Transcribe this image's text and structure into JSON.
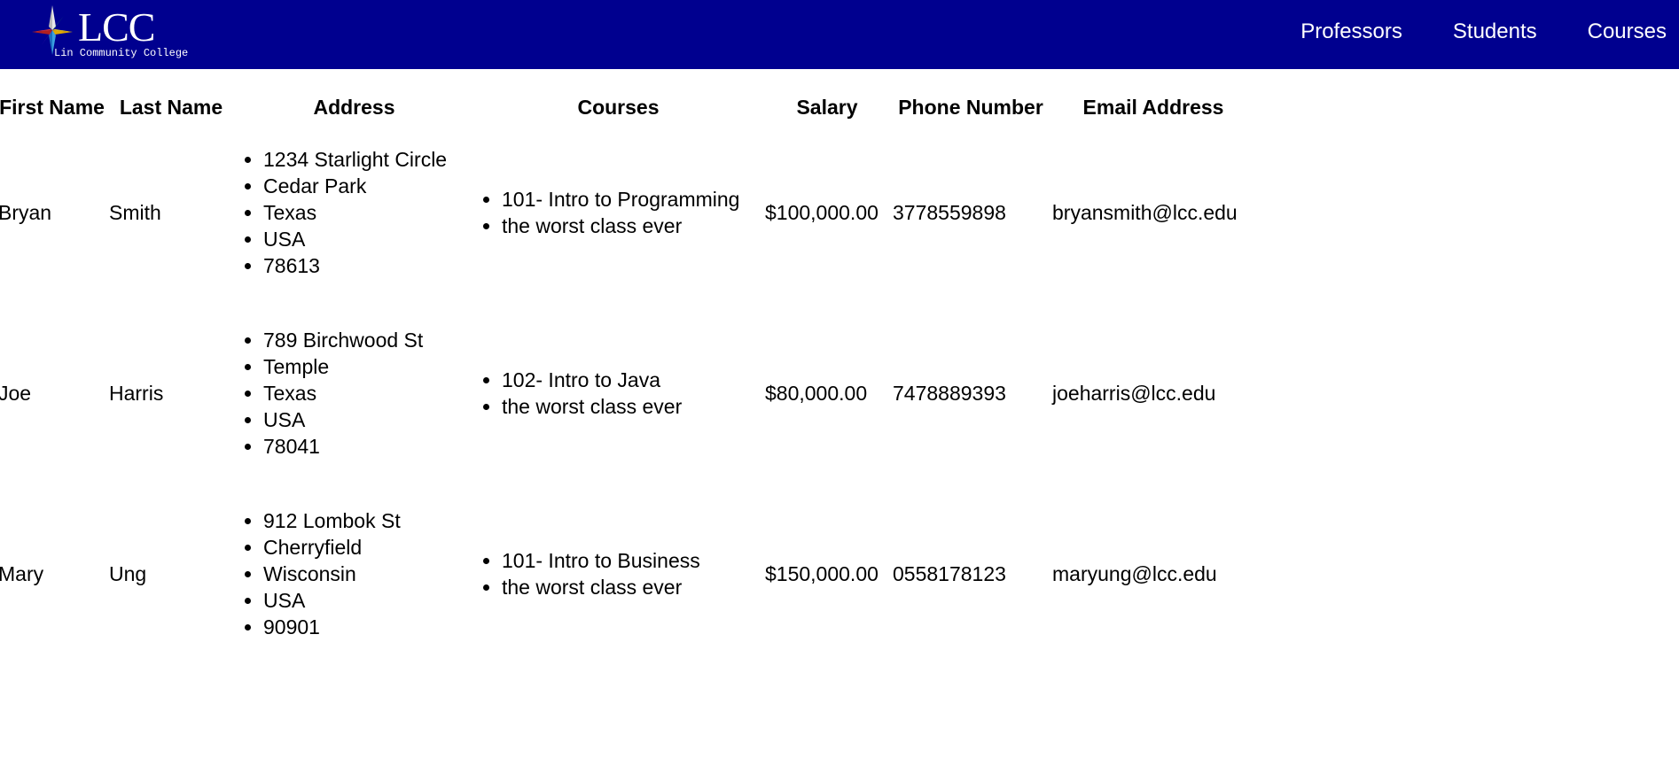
{
  "header": {
    "logo_text": "LCC",
    "logo_subtitle": "Lin Community College",
    "nav": [
      "Professors",
      "Students",
      "Courses"
    ],
    "background_color": "#00008f"
  },
  "table": {
    "columns": [
      "First Name",
      "Last Name",
      "Address",
      "Courses",
      "Salary",
      "Phone Number",
      "Email Address"
    ],
    "rows": [
      {
        "first_name": "Bryan",
        "last_name": "Smith",
        "address": [
          "1234 Starlight Circle",
          "Cedar Park",
          "Texas",
          "USA",
          "78613"
        ],
        "courses": [
          "101- Intro to Programming",
          "the worst class ever"
        ],
        "salary": "$100,000.00",
        "phone": "3778559898",
        "email": "bryansmith@lcc.edu"
      },
      {
        "first_name": "Joe",
        "last_name": "Harris",
        "address": [
          "789 Birchwood St",
          "Temple",
          "Texas",
          "USA",
          "78041"
        ],
        "courses": [
          "102- Intro to Java",
          "the worst class ever"
        ],
        "salary": "$80,000.00",
        "phone": "7478889393",
        "email": "joeharris@lcc.edu"
      },
      {
        "first_name": "Mary",
        "last_name": "Ung",
        "address": [
          "912 Lombok St",
          "Cherryfield",
          "Wisconsin",
          "USA",
          "90901"
        ],
        "courses": [
          "101- Intro to Business",
          "the worst class ever"
        ],
        "salary": "$150,000.00",
        "phone": "0558178123",
        "email": "maryung@lcc.edu"
      }
    ]
  }
}
